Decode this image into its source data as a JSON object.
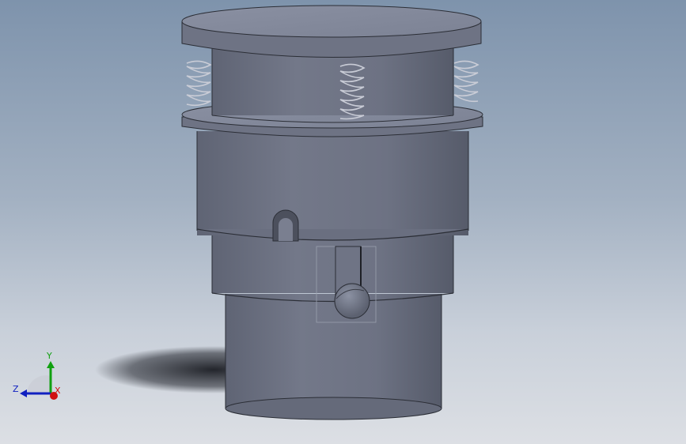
{
  "viewport": {
    "background_top": "#7e93ac",
    "background_bottom": "#dcdfe4",
    "model_color": "#6b7080"
  },
  "triad": {
    "y_label": "Y",
    "z_label": "Z",
    "x_label": "X",
    "x_color": "#d01010",
    "y_color": "#10a010",
    "z_color": "#1020c0"
  }
}
